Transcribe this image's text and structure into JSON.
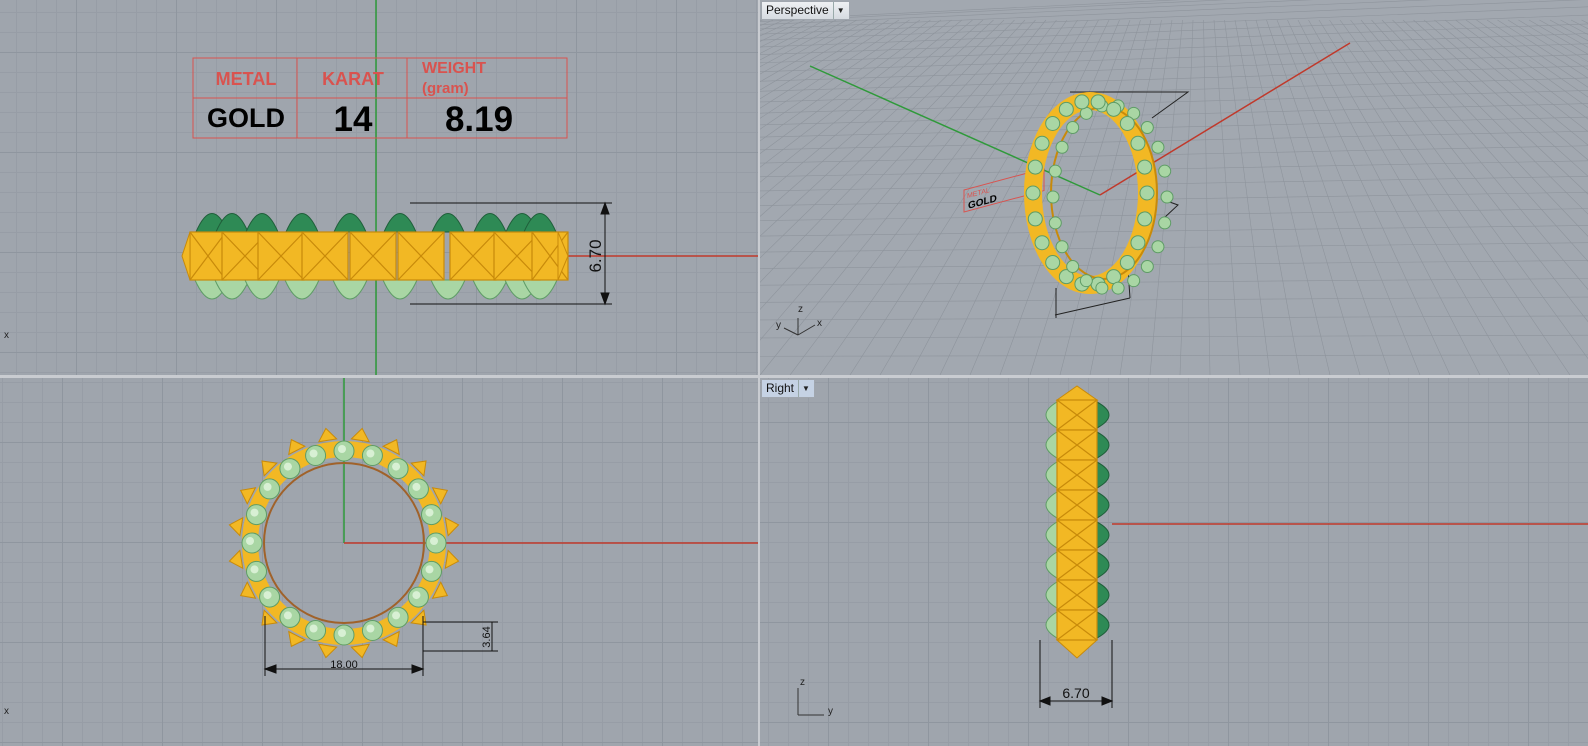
{
  "viewports": {
    "perspective": {
      "label": "Perspective"
    },
    "right": {
      "label": "Right"
    }
  },
  "table": {
    "headers": [
      "METAL",
      "KARAT",
      "WEIGHT",
      "(gram)"
    ],
    "values": [
      "GOLD",
      "14",
      "8.19"
    ]
  },
  "dimensions": {
    "top_height": "6.70",
    "front_width": "18.00",
    "front_height": "3.64",
    "right_width": "6.70"
  },
  "axis_labels": {
    "x": "x",
    "y": "y",
    "z": "z"
  },
  "colors": {
    "gold": "#f2b824",
    "gold_edge": "#c88a0a",
    "gem_light": "#a9d6a4",
    "gem_dark": "#2e8a55",
    "axis_red": "#c0392b",
    "axis_green": "#2f9a3a",
    "table_red": "#d9534f"
  }
}
